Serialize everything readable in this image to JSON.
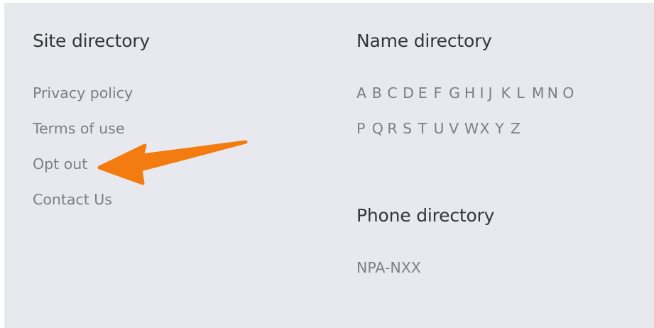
{
  "site_directory": {
    "title": "Site directory",
    "links": [
      "Privacy policy",
      "Terms of use",
      "Opt out",
      "Contact Us"
    ]
  },
  "name_directory": {
    "title": "Name directory",
    "row1": [
      "A",
      "B",
      "C",
      "D",
      "E",
      "F",
      "G",
      "H",
      "I",
      "J",
      "K",
      "L",
      "M",
      "N",
      "O"
    ],
    "row2": [
      "P",
      "Q",
      "R",
      "S",
      "T",
      "U",
      "V",
      "W",
      "X",
      "Y",
      "Z"
    ]
  },
  "phone_directory": {
    "title": "Phone directory",
    "link": "NPA-NXX"
  },
  "colors": {
    "panel_background": "#e8e9ee",
    "heading_text": "#333538",
    "link_text": "#7b7f86",
    "arrow": "#f47b10"
  },
  "annotation": {
    "icon": "orange-arrow-pointing-left"
  }
}
